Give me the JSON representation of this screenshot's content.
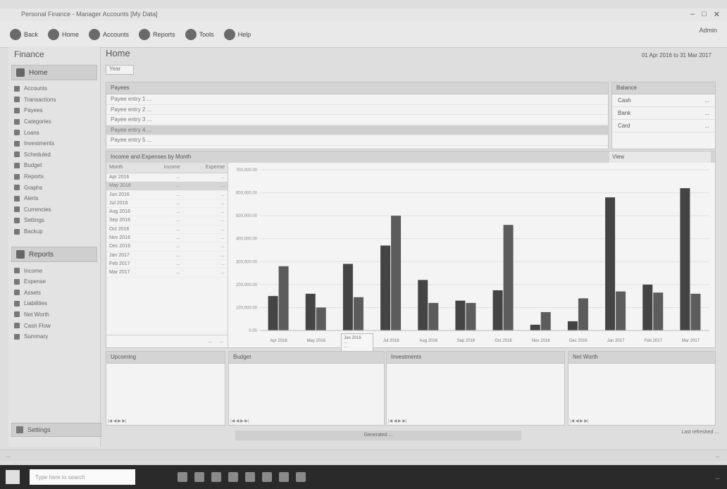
{
  "window": {
    "title": "Personal Finance - Manager Accounts [My Data]"
  },
  "toolbar": {
    "items": [
      {
        "label": "Back",
        "icon": "back-icon"
      },
      {
        "label": "Home",
        "icon": "home-icon"
      },
      {
        "label": "Accounts",
        "icon": "accounts-icon"
      },
      {
        "label": "Reports",
        "icon": "reports-icon"
      },
      {
        "label": "Tools",
        "icon": "tools-icon"
      },
      {
        "label": "Help",
        "icon": "help-icon"
      }
    ],
    "user": "Admin"
  },
  "sidebar": {
    "title": "Finance",
    "section1": "Home",
    "items": [
      "Accounts",
      "Transactions",
      "Payees",
      "Categories",
      "Loans",
      "Investments",
      "Scheduled",
      "Budget",
      "Reports",
      "Graphs",
      "Alerts",
      "Currencies",
      "Settings",
      "Backup"
    ],
    "section2": "Reports",
    "items2": [
      "Income",
      "Expense",
      "Assets",
      "Liabilities",
      "Net Worth",
      "Cash Flow",
      "Summary"
    ],
    "footer": "Settings"
  },
  "main": {
    "title": "Home",
    "date_range": "01 Apr 2016  to  31 Mar 2017",
    "select_value": "Year",
    "payees": {
      "header": "Payees",
      "rows": [
        "Payee entry 1 ...",
        "Payee entry 2 ...",
        "Payee entry 3 ...",
        "Payee entry 4 ...",
        "Payee entry 5 ..."
      ]
    },
    "balance": {
      "header": "Balance",
      "rows": [
        {
          "label": "Cash",
          "value": "..."
        },
        {
          "label": "Bank",
          "value": "..."
        },
        {
          "label": "Card",
          "value": "..."
        }
      ]
    },
    "chart_panel": {
      "header": "Income and Expenses by Month",
      "dropdown": "View"
    },
    "table": {
      "headers": [
        "Month",
        "Income",
        "Expense"
      ],
      "rows": [
        [
          "Apr 2016",
          "...",
          "..."
        ],
        [
          "May 2016",
          "...",
          "..."
        ],
        [
          "Jun 2016",
          "...",
          "..."
        ],
        [
          "Jul 2016",
          "...",
          "..."
        ],
        [
          "Aug 2016",
          "...",
          "..."
        ],
        [
          "Sep 2016",
          "...",
          "..."
        ],
        [
          "Oct 2016",
          "...",
          "..."
        ],
        [
          "Nov 2016",
          "...",
          "..."
        ],
        [
          "Dec 2016",
          "...",
          "..."
        ],
        [
          "Jan 2017",
          "...",
          "..."
        ],
        [
          "Feb 2017",
          "...",
          "..."
        ],
        [
          "Mar 2017",
          "...",
          "..."
        ]
      ],
      "totals": [
        "...",
        "..."
      ]
    },
    "tooltip": {
      "title": "Jun 2016",
      "line1": "...",
      "line2": "..."
    },
    "bottom_panels": [
      {
        "title": "Upcoming"
      },
      {
        "title": "Budget"
      },
      {
        "title": "Investments"
      },
      {
        "title": "Net Worth"
      }
    ],
    "generated_label": "Generated ...",
    "refresh_label": "Last refreshed ..."
  },
  "chart_data": {
    "type": "bar",
    "categories": [
      "Apr 2016",
      "May 2016",
      "Jun 2016",
      "Jul 2016",
      "Aug 2016",
      "Sep 2016",
      "Oct 2016",
      "Nov 2016",
      "Dec 2016",
      "Jan 2017",
      "Feb 2017",
      "Mar 2017"
    ],
    "y_ticks": [
      "0.00",
      "100,000.00",
      "200,000.00",
      "300,000.00",
      "400,000.00",
      "500,000.00",
      "600,000.00",
      "700,000.00"
    ],
    "ylim": [
      0,
      700000
    ],
    "series": [
      {
        "values": [
          150000,
          160000,
          290000,
          370000,
          220000,
          130000,
          175000,
          25000,
          40000,
          580000,
          200000,
          620000
        ]
      },
      {
        "values": [
          280000,
          100000,
          145000,
          500000,
          120000,
          120000,
          460000,
          80000,
          140000,
          170000,
          165000,
          160000
        ]
      }
    ],
    "colors": [
      "#444444",
      "#5c5c5c"
    ]
  },
  "statusbar": {
    "left": "...",
    "right": "..."
  },
  "taskbar": {
    "search_placeholder": "Type here to search",
    "clock": "..."
  }
}
